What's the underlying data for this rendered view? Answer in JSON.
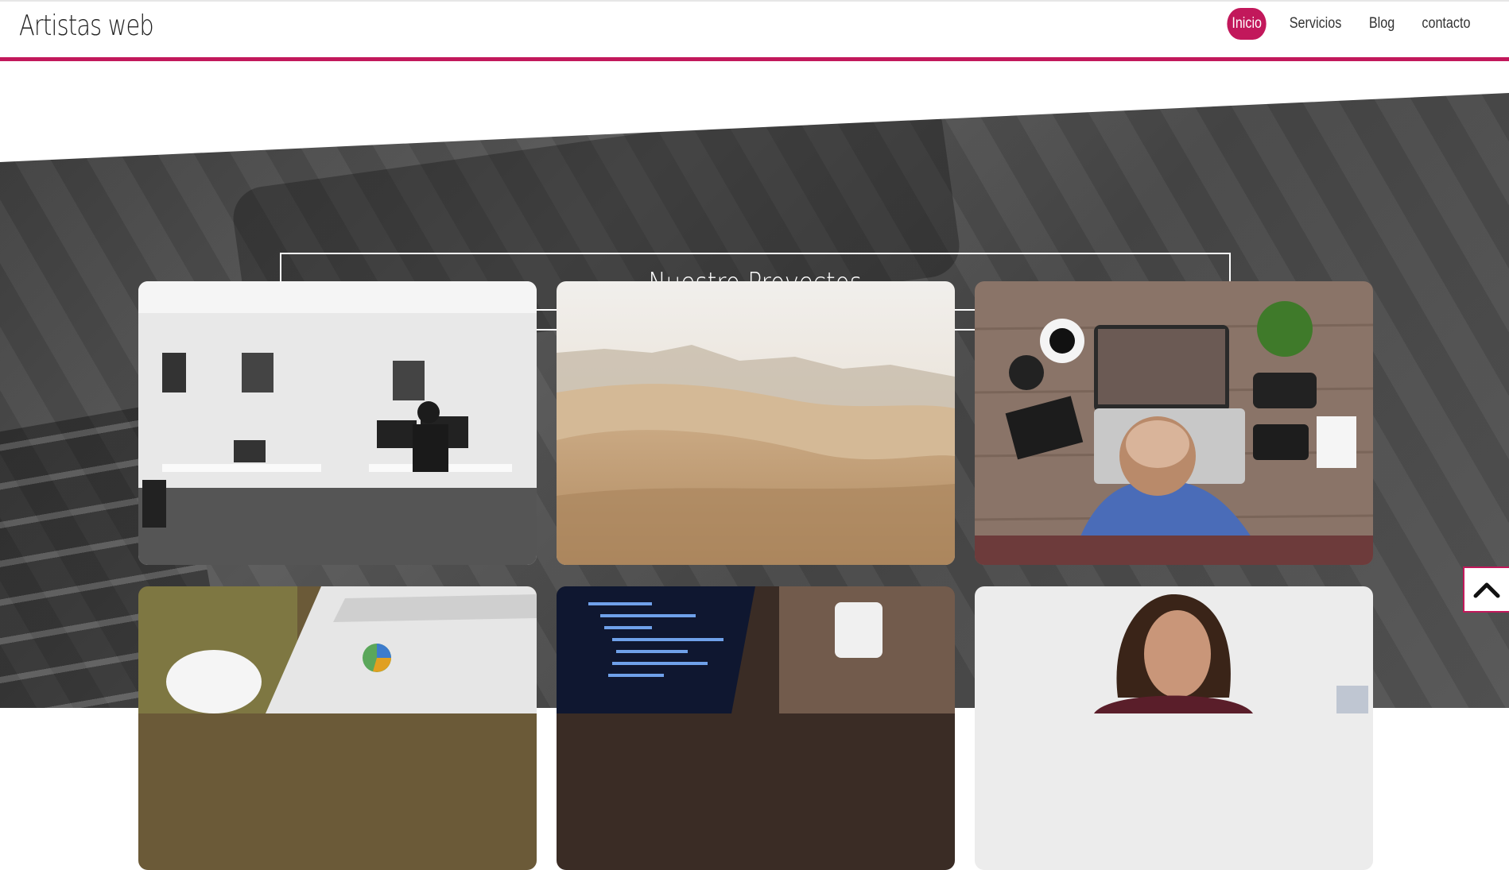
{
  "brand": "Artistas web",
  "nav": [
    {
      "label": "Inicio",
      "active": true
    },
    {
      "label": "Servicios",
      "active": false
    },
    {
      "label": "Blog",
      "active": false
    },
    {
      "label": "contacto",
      "active": false
    }
  ],
  "section_title": "Nuestro Proyectos",
  "projects": [
    {
      "image": "office-desk-bw"
    },
    {
      "image": "desert-dunes"
    },
    {
      "image": "stressed-man-laptop"
    },
    {
      "image": "analytics-tablet-coffee"
    },
    {
      "image": "code-on-laptop"
    },
    {
      "image": "woman-working"
    }
  ],
  "colors": {
    "accent": "#c2185b",
    "hero_dark": "#4a4a4a"
  },
  "icons": {
    "scroll_top": "chevron-up-icon"
  }
}
